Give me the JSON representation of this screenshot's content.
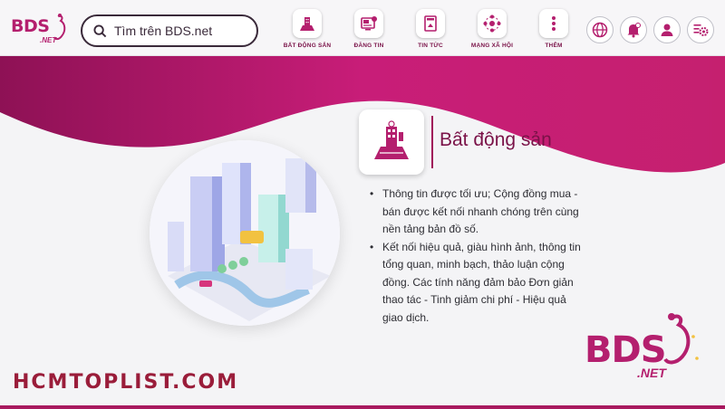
{
  "brand": {
    "logo_text": "BDS",
    "logo_sub": ".NET"
  },
  "search": {
    "placeholder": "Tìm trên BDS.net"
  },
  "nav": {
    "items": [
      {
        "label": "Bất động sản",
        "icon": "building-icon"
      },
      {
        "label": "Đăng tin",
        "icon": "post-icon"
      },
      {
        "label": "Tin tức",
        "icon": "news-icon"
      },
      {
        "label": "Mạng xã hội",
        "icon": "social-network-icon"
      },
      {
        "label": "Thêm",
        "icon": "more-icon"
      }
    ]
  },
  "toolbar": {
    "icons": [
      "globe-icon",
      "notification-bell-icon",
      "user-icon",
      "settings-list-icon"
    ]
  },
  "feature": {
    "title": "Bất động sản",
    "bullets": [
      "Thông tin được tối ưu; Cộng đồng mua - bán được kết nối nhanh chóng trên cùng nền tảng bản đồ số.",
      "Kết nối hiệu quả, giàu hình ảnh, thông tin tổng quan, minh bạch, thảo luận cộng đồng. Các tính năng đảm bảo Đơn giản thao tác - Tinh giảm chi phí - Hiệu quả giao dịch."
    ]
  },
  "footer_logo": {
    "text": "BDS",
    "sub": ".NET"
  },
  "watermark": "HCMTOPLIST.COM",
  "colors": {
    "brand": "#b41f6e",
    "dark_brand": "#7a1248",
    "accent": "#a8195f"
  }
}
